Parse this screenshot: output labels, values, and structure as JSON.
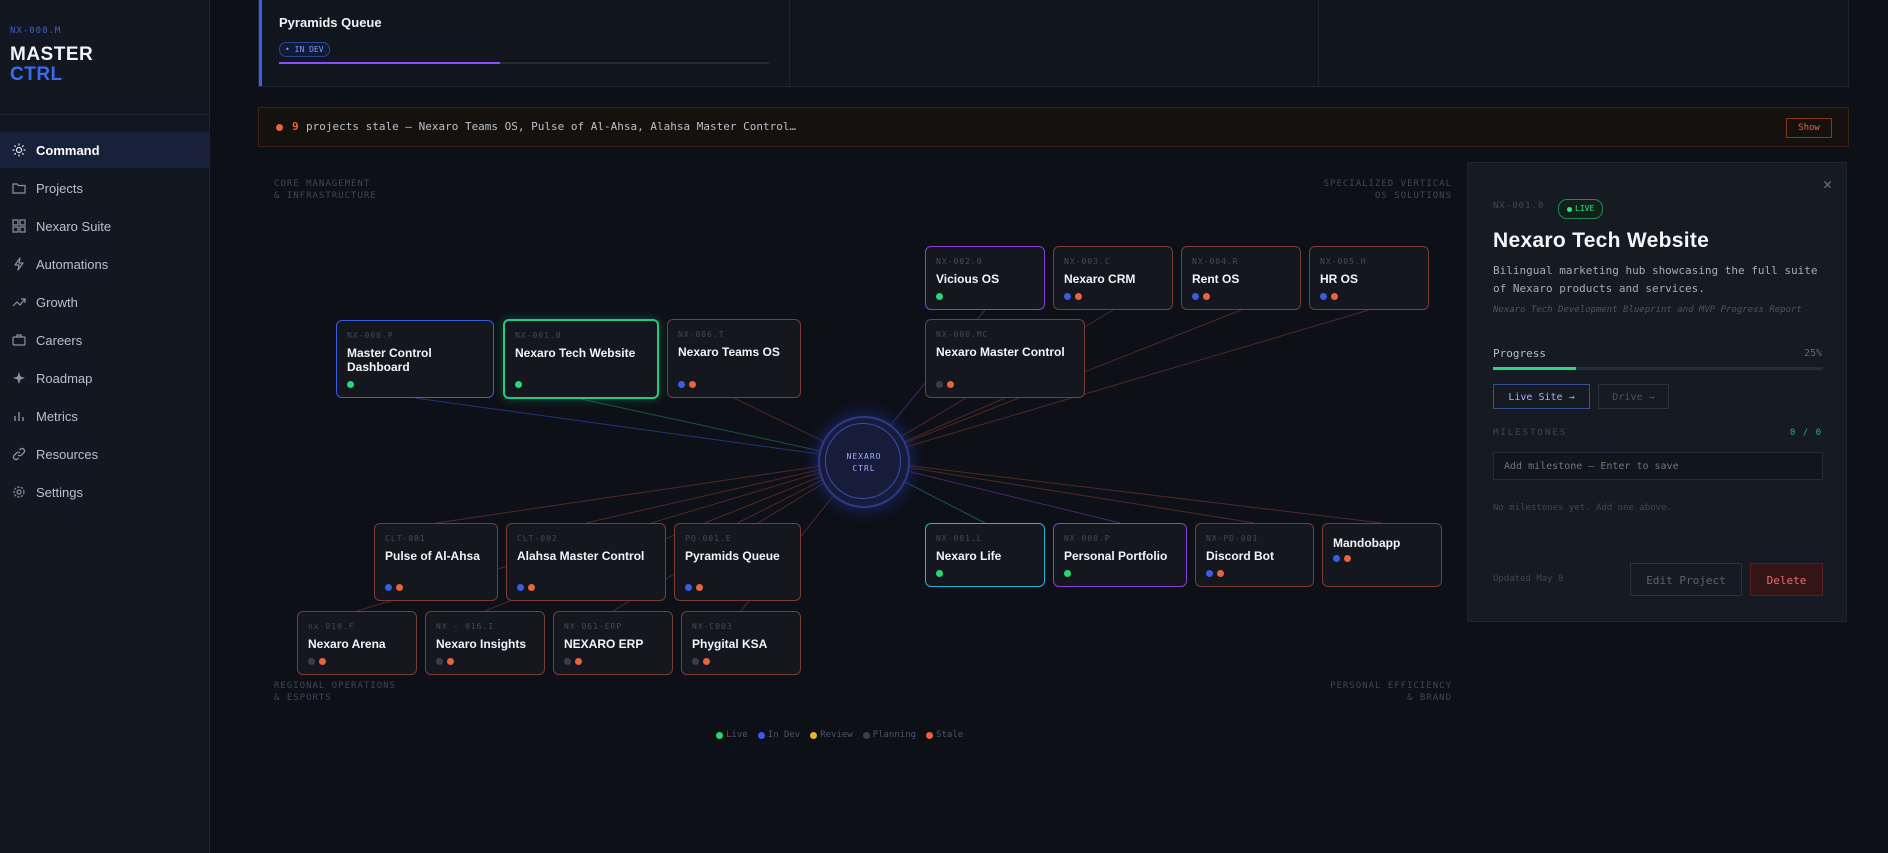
{
  "brand": {
    "code": "NX-000.M",
    "title1": "MASTER",
    "title2": "CTRL"
  },
  "nav": [
    {
      "label": "Command",
      "icon": "sun-icon"
    },
    {
      "label": "Projects",
      "icon": "folder-icon"
    },
    {
      "label": "Nexaro Suite",
      "icon": "grid-icon"
    },
    {
      "label": "Automations",
      "icon": "bolt-icon"
    },
    {
      "label": "Growth",
      "icon": "trend-icon"
    },
    {
      "label": "Careers",
      "icon": "briefcase-icon"
    },
    {
      "label": "Roadmap",
      "icon": "sparkle-icon"
    },
    {
      "label": "Metrics",
      "icon": "bars-icon"
    },
    {
      "label": "Resources",
      "icon": "link-icon"
    },
    {
      "label": "Settings",
      "icon": "gear-icon"
    }
  ],
  "top_card": {
    "name": "Pyramids Queue",
    "badge": "• IN DEV",
    "progress": 0.45
  },
  "alert": {
    "count": "9",
    "message": "projects stale — Nexaro Teams OS, Pulse of Al-Ahsa, Alahsa Master Control…",
    "button": "Show"
  },
  "graph": {
    "corners": {
      "tl1": "CORE MANAGEMENT",
      "tl2": "& INFRASTRUCTURE",
      "tr1": "SPECIALIZED VERTICAL",
      "tr2": "OS SOLUTIONS",
      "bl1": "REGIONAL OPERATIONS",
      "bl2": "& ESPORTS",
      "br1": "PERSONAL EFFICIENCY",
      "br2": "& BRAND"
    },
    "hub": {
      "line1": "NEXARO",
      "line2": "CTRL"
    },
    "nodes": [
      {
        "id": "NX-000.P",
        "name": "Master Control Dashboard",
        "dots": [
          "#27d878"
        ]
      },
      {
        "id": "NX-001.0",
        "name": "Nexaro Tech Website",
        "dots": [
          "#27d878"
        ]
      },
      {
        "id": "NX-006.T",
        "name": "Nexaro Teams OS",
        "dots": [
          "#3b5ce4",
          "#e8643c"
        ]
      },
      {
        "id": "NX-002.0",
        "name": "Vicious OS",
        "dots": [
          "#27d878"
        ]
      },
      {
        "id": "NX-003.C",
        "name": "Nexaro CRM",
        "dots": [
          "#3b5ce4",
          "#e8643c"
        ]
      },
      {
        "id": "NX-004.R",
        "name": "Rent OS",
        "dots": [
          "#3b5ce4",
          "#e8643c"
        ]
      },
      {
        "id": "NX-005.H",
        "name": "HR OS",
        "dots": [
          "#3b5ce4",
          "#e8643c"
        ]
      },
      {
        "id": "NX-000.MC",
        "name": "Nexaro Master Control",
        "dots": [
          "#3a404b",
          "#e8643c"
        ]
      },
      {
        "id": "CLT-001",
        "name": "Pulse of Al-Ahsa",
        "dots": [
          "#3b5ce4",
          "#e8643c"
        ]
      },
      {
        "id": "CLT-002",
        "name": "Alahsa Master Control",
        "dots": [
          "#3b5ce4",
          "#e8643c"
        ]
      },
      {
        "id": "PQ-001.E",
        "name": "Pyramids Queue",
        "dots": [
          "#3b5ce4",
          "#e8643c"
        ]
      },
      {
        "id": "NX-001.L",
        "name": "Nexaro Life",
        "dots": [
          "#27d878"
        ]
      },
      {
        "id": "NX-000.P",
        "name": "Personal Portfolio",
        "dots": [
          "#27d878"
        ]
      },
      {
        "id": "NX-PD-001",
        "name": "Discord Bot",
        "dots": [
          "#3b5ce4",
          "#e8643c"
        ]
      },
      {
        "id": "",
        "name": "Mandobapp",
        "dots": [
          "#3b5ce4",
          "#e8643c"
        ]
      },
      {
        "id": "nx-010.F",
        "name": "Nexaro Arena",
        "dots": [
          "#3a404b",
          "#e8643c"
        ]
      },
      {
        "id": "NX - 016.I",
        "name": "Nexaro Insights",
        "dots": [
          "#3a404b",
          "#e8643c"
        ]
      },
      {
        "id": "NX-061-ERP",
        "name": "NEXARO ERP",
        "dots": [
          "#3a404b",
          "#e8643c"
        ]
      },
      {
        "id": "NX-C003",
        "name": "Phygital KSA",
        "dots": [
          "#3a404b",
          "#e8643c"
        ]
      }
    ],
    "legend": [
      {
        "label": "Live",
        "color": "#27d878"
      },
      {
        "label": "In Dev",
        "color": "#3b5ce4"
      },
      {
        "label": "Review",
        "color": "#e8b23c"
      },
      {
        "label": "Planning",
        "color": "#3a404b"
      },
      {
        "label": "Stale",
        "color": "#e8643c"
      }
    ]
  },
  "panel": {
    "close": "✕",
    "id": "NX-001.0",
    "status": "LIVE",
    "title": "Nexaro Tech Website",
    "description": "Bilingual marketing hub showcasing the full suite of Nexaro products and services.",
    "subtitle": "Nexaro Tech Development Blueprint and MVP Progress Report",
    "progress_label": "Progress",
    "progress_value": "25%",
    "progress": 0.25,
    "live_site": "Live Site →",
    "drive": "Drive →",
    "milestones_label": "MILESTONES",
    "milestones_count": "0 / 0",
    "milestone_placeholder": "Add milestone — Enter to save",
    "milestones_empty": "No milestones yet. Add one above.",
    "updated": "Updated May 8",
    "edit": "Edit Project",
    "delete": "Delete"
  },
  "colors": {
    "accent": "#3b6cf0",
    "live": "#27d878",
    "stale": "#e8643c",
    "in_dev": "#3b5ce4"
  }
}
